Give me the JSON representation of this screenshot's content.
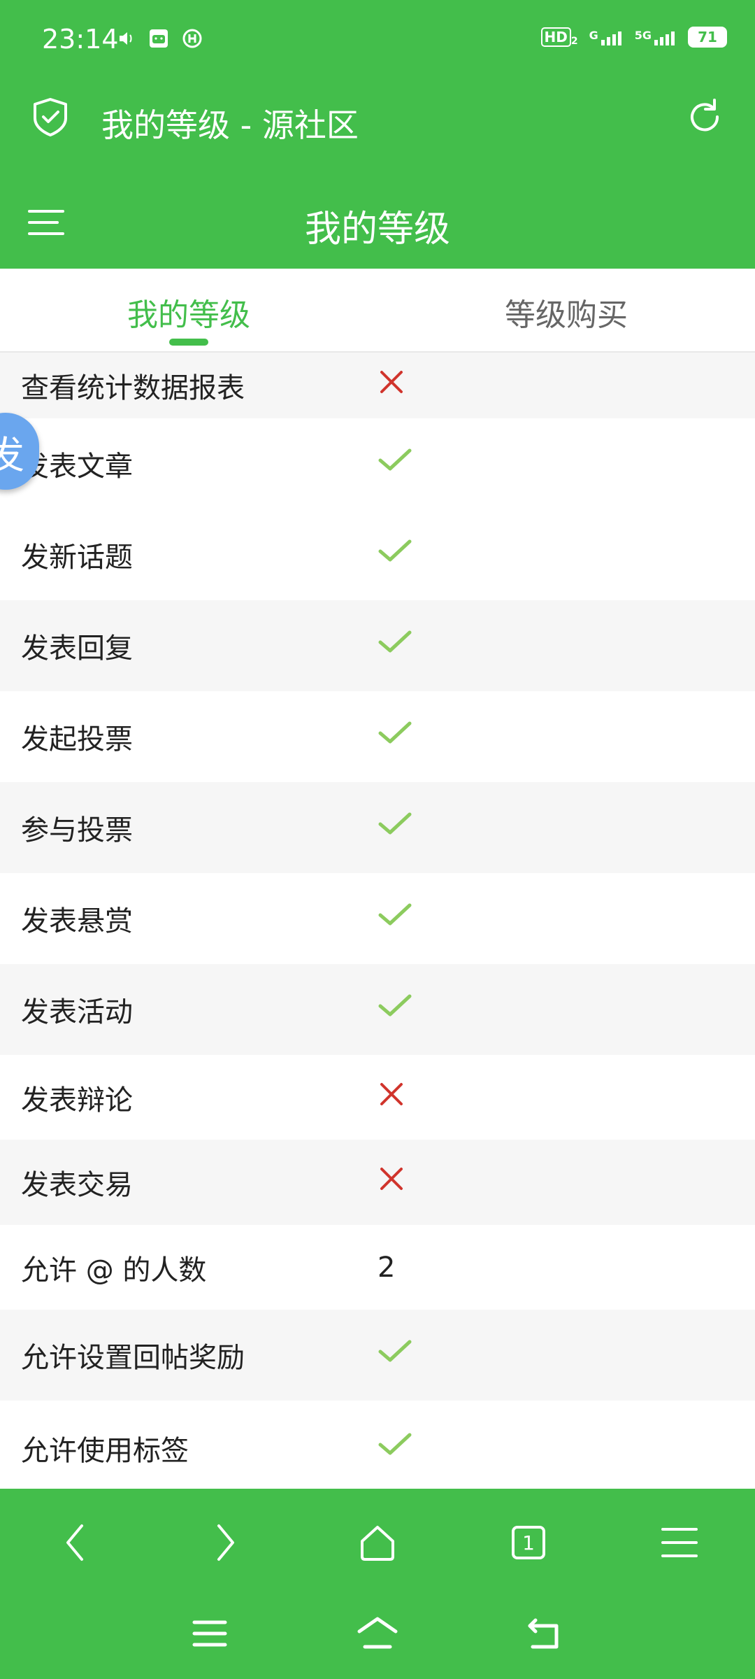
{
  "status": {
    "time": "23:14",
    "hd": "HD",
    "hd_sub": "2",
    "net1": "G",
    "net2": "5G",
    "battery": "71"
  },
  "browser": {
    "title": "我的等级 - 源社区"
  },
  "page": {
    "title": "我的等级"
  },
  "tabs": [
    {
      "label": "我的等级"
    },
    {
      "label": "等级购买"
    }
  ],
  "float_button": {
    "label": "发"
  },
  "rows": [
    {
      "label": "查看统计数据报表",
      "value_type": "no"
    },
    {
      "label": "发表文章",
      "value_type": "yes"
    },
    {
      "label": "发新话题",
      "value_type": "yes"
    },
    {
      "label": "发表回复",
      "value_type": "yes"
    },
    {
      "label": "发起投票",
      "value_type": "yes"
    },
    {
      "label": "参与投票",
      "value_type": "yes"
    },
    {
      "label": "发表悬赏",
      "value_type": "yes"
    },
    {
      "label": "发表活动",
      "value_type": "yes"
    },
    {
      "label": "发表辩论",
      "value_type": "no"
    },
    {
      "label": "发表交易",
      "value_type": "no"
    },
    {
      "label": "允许 @ 的人数",
      "value_type": "text",
      "value": "2"
    },
    {
      "label": "允许设置回帖奖励",
      "value_type": "yes"
    },
    {
      "label": "允许使用标签",
      "value_type": "yes"
    }
  ],
  "browser_nav": {
    "tab_count": "1"
  },
  "colors": {
    "brand": "#43BE4B",
    "check": "#8CCB5E",
    "cross": "#D0342C"
  }
}
